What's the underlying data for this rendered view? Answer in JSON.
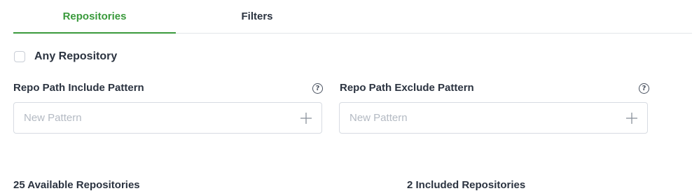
{
  "tabs": [
    {
      "label": "Repositories",
      "active": true
    },
    {
      "label": "Filters",
      "active": false
    }
  ],
  "any_repository": {
    "label": "Any Repository",
    "checked": false
  },
  "include_pattern": {
    "label": "Repo Path Include Pattern",
    "placeholder": "New Pattern",
    "value": "",
    "help_icon": "question-circle-icon",
    "add_icon": "plus-icon"
  },
  "exclude_pattern": {
    "label": "Repo Path Exclude Pattern",
    "placeholder": "New Pattern",
    "value": "",
    "help_icon": "question-circle-icon",
    "add_icon": "plus-icon"
  },
  "available": {
    "title": "25 Available Repositories"
  },
  "included": {
    "title": "2 Included Repositories"
  },
  "colors": {
    "accent": "#3a9a3c",
    "text": "#2b3340",
    "border": "#d7dbe2",
    "placeholder": "#b4bac3"
  }
}
